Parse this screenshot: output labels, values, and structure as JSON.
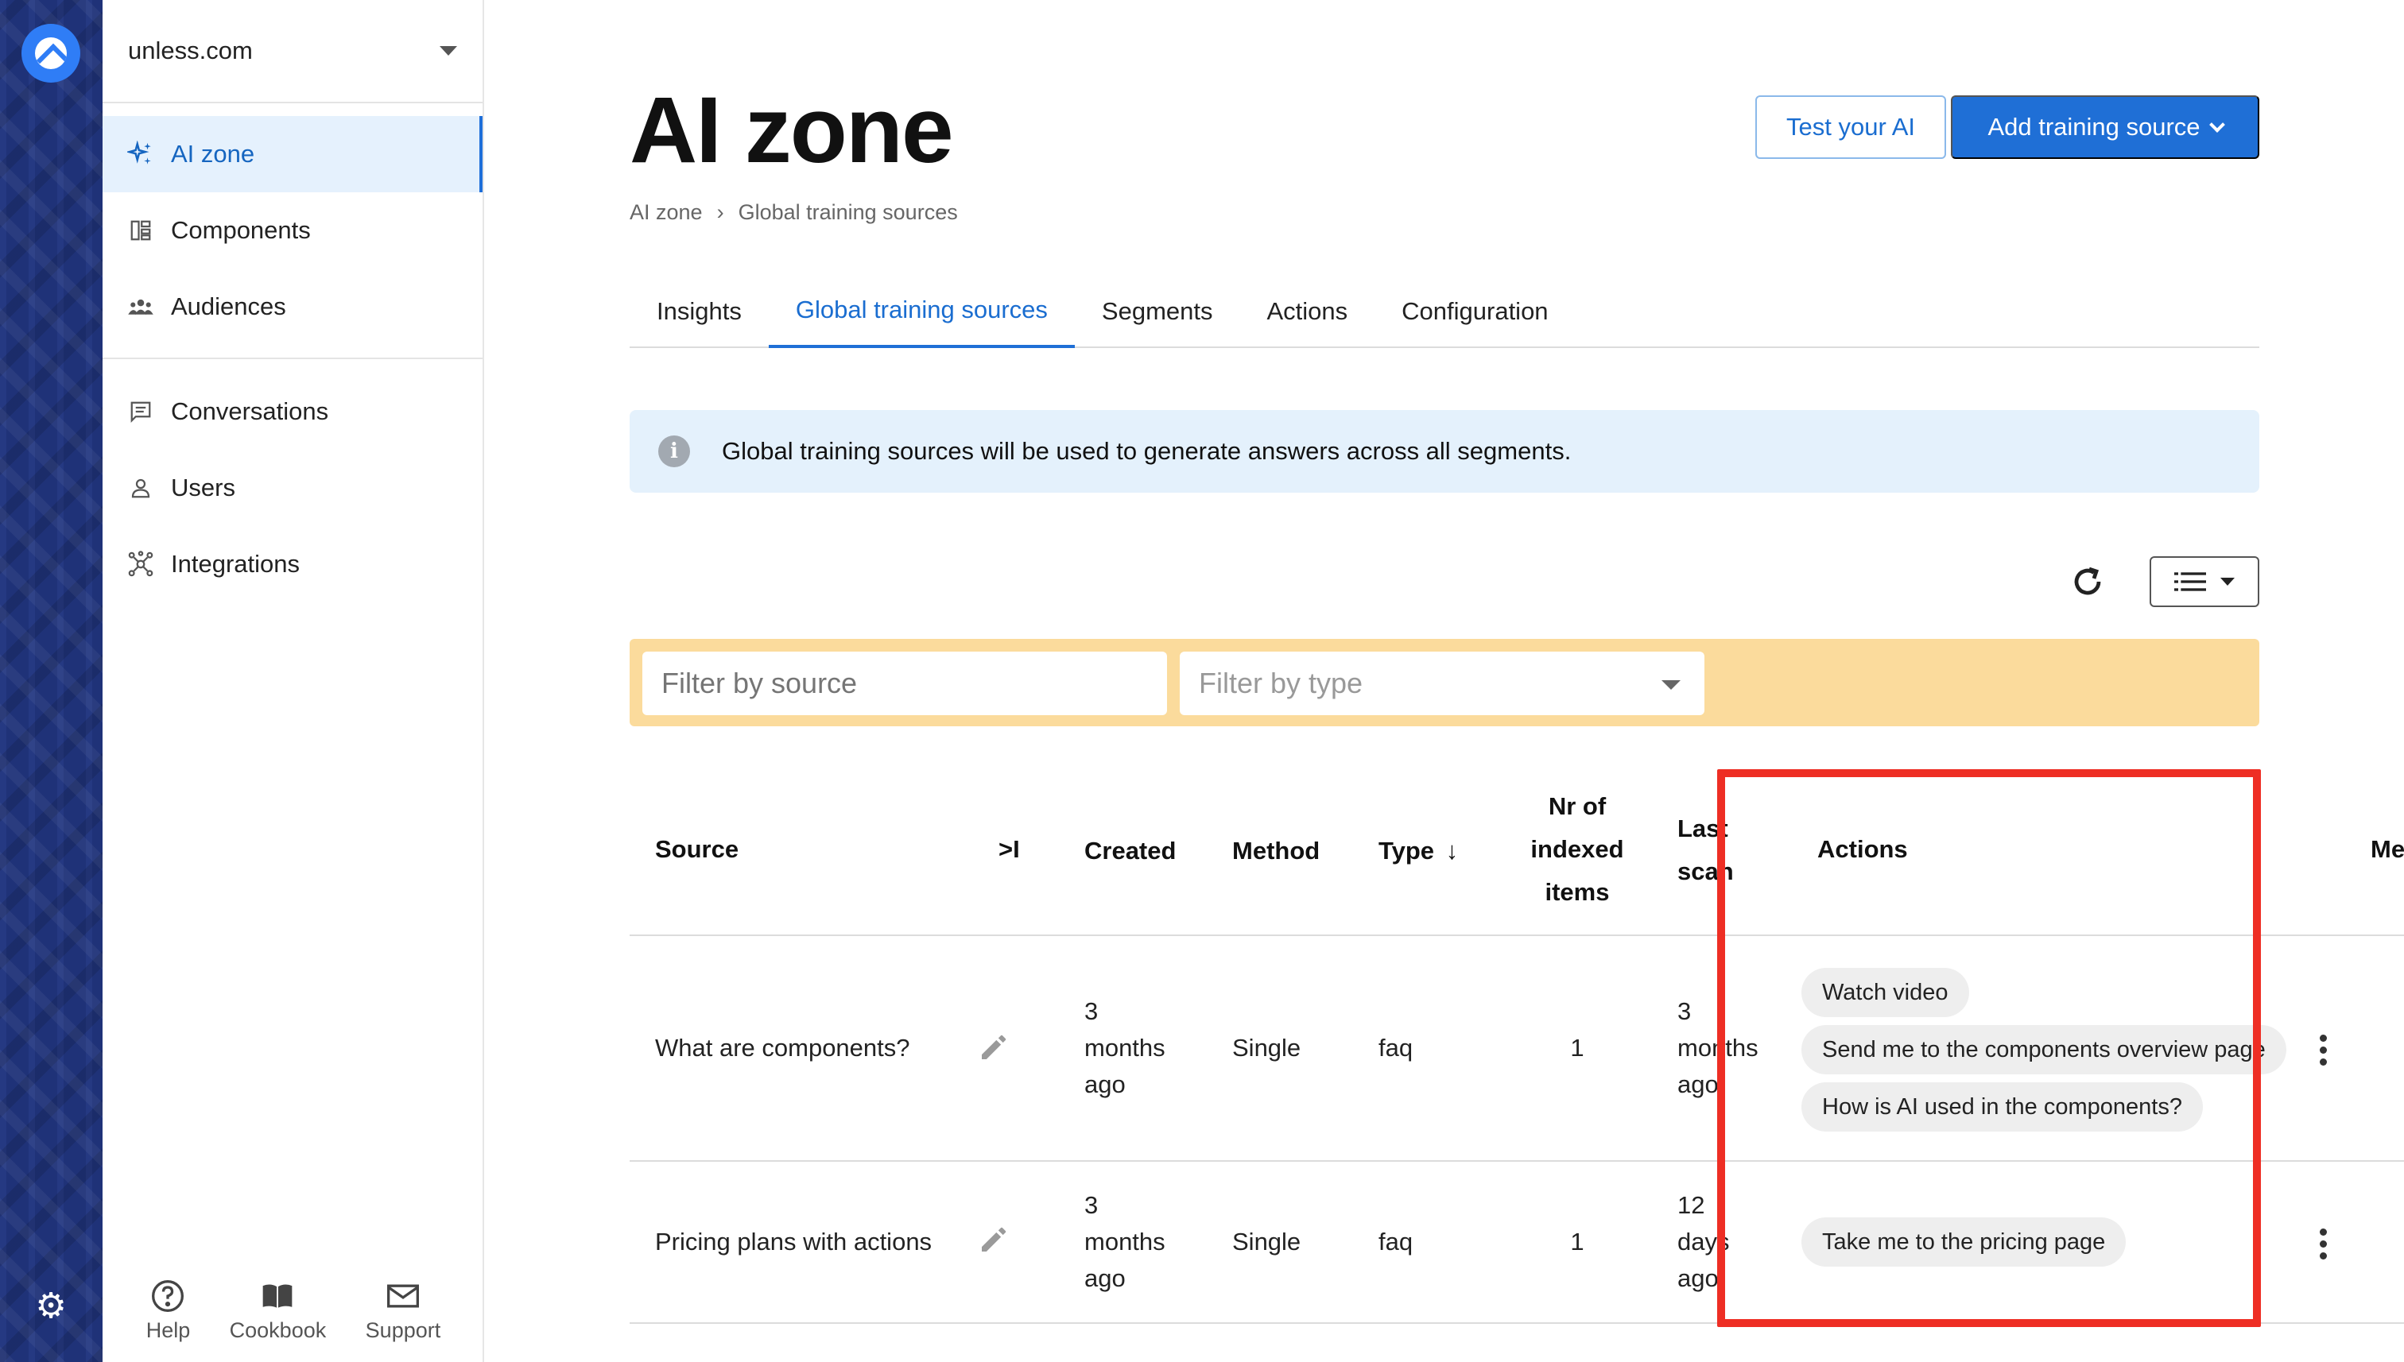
{
  "sidebar": {
    "org_name": "unless.com",
    "items": [
      {
        "label": "AI zone",
        "icon": "sparkle-icon",
        "active": true
      },
      {
        "label": "Components",
        "icon": "components-icon"
      },
      {
        "label": "Audiences",
        "icon": "audiences-icon"
      },
      {
        "label": "Conversations",
        "icon": "chat-icon"
      },
      {
        "label": "Users",
        "icon": "user-icon"
      },
      {
        "label": "Integrations",
        "icon": "integrations-icon"
      }
    ],
    "bottom": [
      {
        "label": "Help",
        "icon": "help-icon"
      },
      {
        "label": "Cookbook",
        "icon": "book-icon"
      },
      {
        "label": "Support",
        "icon": "mail-icon"
      }
    ]
  },
  "header": {
    "title": "AI zone",
    "test_button": "Test your AI",
    "add_button": "Add training source"
  },
  "breadcrumb": {
    "root": "AI zone",
    "separator": "›",
    "current": "Global training sources"
  },
  "tabs": [
    {
      "label": "Insights"
    },
    {
      "label": "Global training sources",
      "active": true
    },
    {
      "label": "Segments"
    },
    {
      "label": "Actions"
    },
    {
      "label": "Configuration"
    }
  ],
  "info_text": "Global training sources will be used to generate answers across all segments.",
  "filters": {
    "source_placeholder": "Filter by source",
    "type_placeholder": "Filter by type"
  },
  "table": {
    "headers": {
      "source": "Source",
      "expand": ">I",
      "created": "Created",
      "method": "Method",
      "type": "Type",
      "type_sort": "↓",
      "indexed_1": "Nr of",
      "indexed_2": "indexed",
      "indexed_3": "items",
      "scan_1": "Last",
      "scan_2": "scan",
      "actions": "Actions",
      "menu": "Menu"
    },
    "rows": [
      {
        "source": "What are components?",
        "created_1": "3",
        "created_2": "months",
        "created_3": "ago",
        "method": "Single",
        "type": "faq",
        "indexed": "1",
        "scan_1": "3",
        "scan_2": "months",
        "scan_3": "ago",
        "actions": [
          "Watch video",
          "Send me to the components overview page",
          "How is AI used in the components?"
        ]
      },
      {
        "source": "Pricing plans with actions",
        "created_1": "3",
        "created_2": "months",
        "created_3": "ago",
        "method": "Single",
        "type": "faq",
        "indexed": "1",
        "scan_1": "12",
        "scan_2": "days",
        "scan_3": "ago",
        "actions": [
          "Take me to the pricing page"
        ]
      }
    ]
  },
  "colors": {
    "primary": "#1f6fd6",
    "highlight": "#ee2e24",
    "filter_bar": "#fbdb9c",
    "info_bg": "#e4f1fc"
  }
}
